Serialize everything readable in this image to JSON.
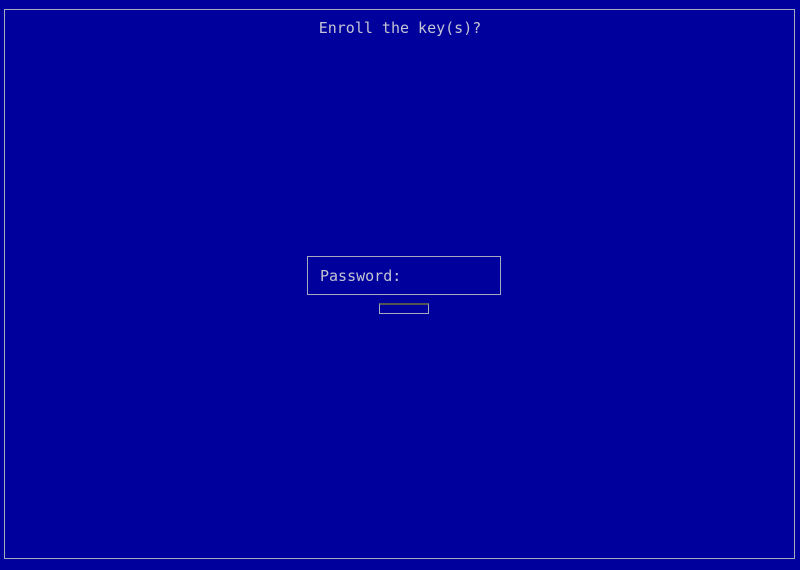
{
  "dialog": {
    "title": "Enroll the key(s)?",
    "password_label": "Password:",
    "password_value": "",
    "confirm_button_label": ""
  },
  "colors": {
    "background": "#00009c",
    "foreground": "#c4c4d4",
    "border": "#a8a8c0"
  }
}
